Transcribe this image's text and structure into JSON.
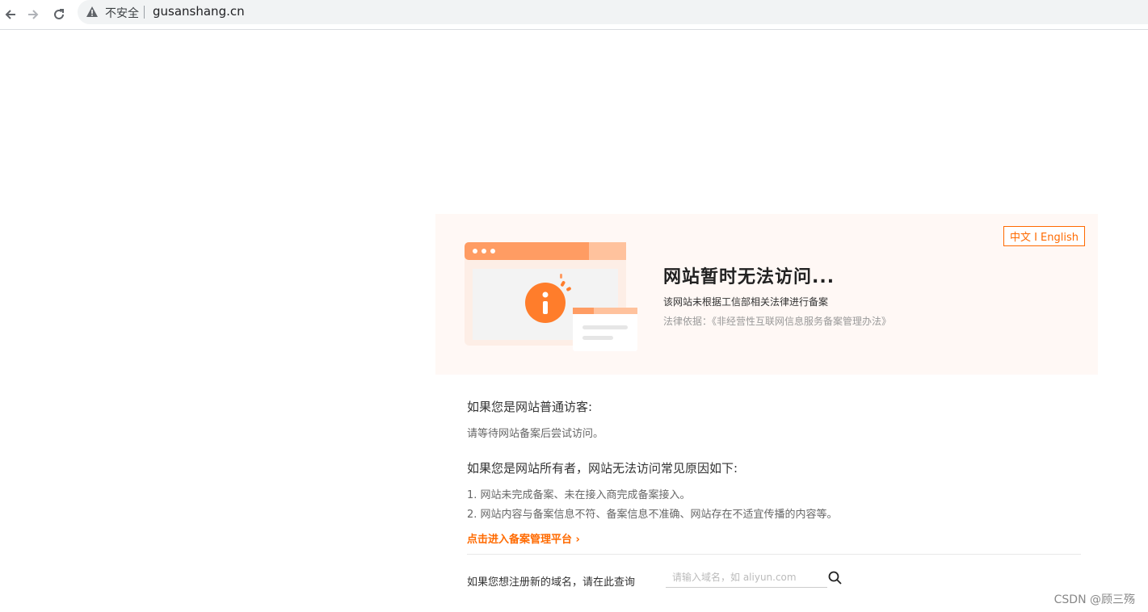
{
  "browser": {
    "security_label": "不安全",
    "url": "gusanshang.cn"
  },
  "banner": {
    "language_toggle": "中文 I English",
    "title": "网站暂时无法访问...",
    "description": "该网站未根据工信部相关法律进行备案",
    "legal_basis": "法律依据：《非经营性互联网信息服务备案管理办法》"
  },
  "visitor": {
    "heading": "如果您是网站普通访客:",
    "text": "请等待网站备案后尝试访问。"
  },
  "owner": {
    "heading": "如果您是网站所有者，网站无法访问常见原因如下:",
    "reasons": [
      "1. 网站未完成备案、未在接入商完成备案接入。",
      "2. 网站内容与备案信息不符、备案信息不准确、网站存在不适宜传播的内容等。"
    ],
    "link": "点击进入备案管理平台 ›"
  },
  "domain_search": {
    "label": "如果您想注册新的域名，请在此查询",
    "placeholder": "请输入域名，如 aliyun.com"
  },
  "watermark": "CSDN @顾三殇",
  "colors": {
    "accent": "#ff6a00",
    "banner_bg": "#fff8f5"
  }
}
